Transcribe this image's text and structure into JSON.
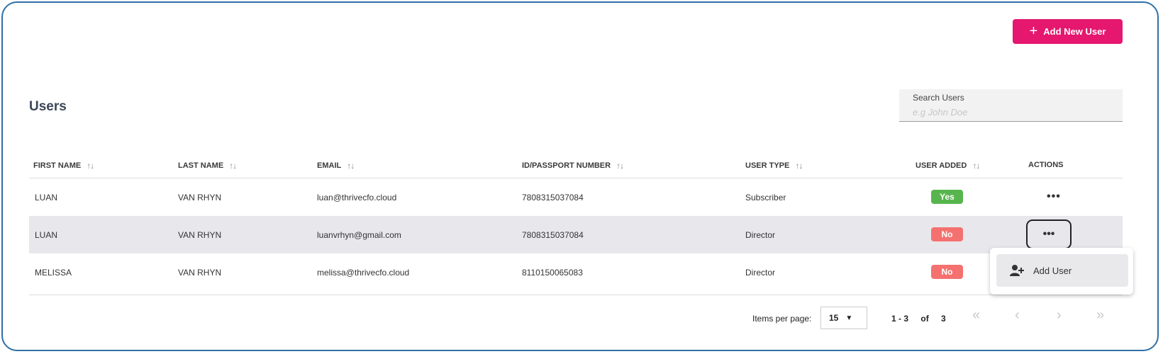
{
  "header": {
    "add_user_label": "Add New User"
  },
  "page": {
    "title": "Users"
  },
  "search": {
    "label": "Search Users",
    "placeholder": "e.g John Doe"
  },
  "table": {
    "columns": [
      "FIRST NAME",
      "LAST NAME",
      "EMAIL",
      "ID/PASSPORT NUMBER",
      "USER TYPE",
      "USER ADDED",
      "ACTIONS"
    ],
    "rows": [
      {
        "first_name": "LUAN",
        "last_name": "VAN RHYN",
        "email": "luan@thrivecfo.cloud",
        "id_number": "7808315037084",
        "user_type": "Subscriber",
        "user_added": "Yes"
      },
      {
        "first_name": "LUAN",
        "last_name": "VAN RHYN",
        "email": "luanvrhyn@gmail.com",
        "id_number": "7808315037084",
        "user_type": "Director",
        "user_added": "No"
      },
      {
        "first_name": "MELISSA",
        "last_name": "VAN RHYN",
        "email": "melissa@thrivecfo.cloud",
        "id_number": "8110150065083",
        "user_type": "Director",
        "user_added": "No"
      }
    ],
    "actions_glyph": "•••"
  },
  "context_menu": {
    "item_label": "Add User",
    "item_icon": "user-plus-icon"
  },
  "pagination": {
    "items_per_page_label": "Items per page:",
    "items_per_page_value": "15",
    "range_text": "1 - 3",
    "of_label": "of",
    "total": "3"
  },
  "colors": {
    "accent": "#e5176f",
    "yes": "#58b54e",
    "no": "#f4716f",
    "frame": "#2f6fa6"
  }
}
